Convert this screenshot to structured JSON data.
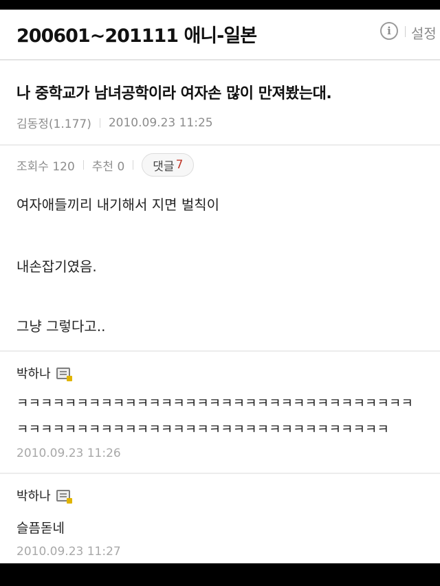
{
  "header": {
    "cafe_board_title": "200601~201111 애니-일본",
    "info_icon": "i",
    "settings_label": "설정"
  },
  "post": {
    "title": "나 중학교가 남녀공학이라 여자손 많이 만져봤는대.",
    "author": "김동정(1.177)",
    "date": "2010.09.23 11:25",
    "views_label": "조회수 120",
    "likes_label": "추천 0",
    "comments_label": "댓글",
    "comments_count": "7",
    "body_lines": [
      "여자애들끼리 내기해서 지면 벌칙이",
      "내손잡기였음.",
      "그냥 그렇다고.."
    ]
  },
  "comments": [
    {
      "author": "박하나",
      "lines": [
        "ㅋㅋㅋㅋㅋㅋㅋㅋㅋㅋㅋㅋㅋㅋㅋㅋㅋㅋㅋㅋㅋㅋㅋㅋㅋㅋㅋㅋㅋㅋㅋㅋㅋ",
        "ㅋㅋㅋㅋㅋㅋㅋㅋㅋㅋㅋㅋㅋㅋㅋㅋㅋㅋㅋㅋㅋㅋㅋㅋㅋㅋㅋㅋㅋㅋㅋ"
      ],
      "date": "2010.09.23 11:26"
    },
    {
      "author": "박하나",
      "lines": [
        "슬픔돋네"
      ],
      "date": "2010.09.23 11:27"
    }
  ]
}
